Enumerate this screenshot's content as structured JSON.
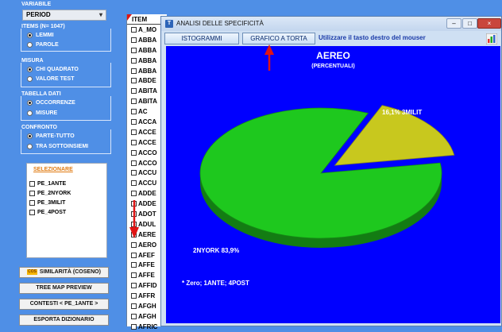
{
  "left_panel": {
    "variable": {
      "title": "VARIABILE",
      "selected": "PERIOD"
    },
    "items": {
      "title": "ITEMS (N= 1047)",
      "options": [
        "LEMMI",
        "PAROLE"
      ],
      "selected_index": 0
    },
    "measure": {
      "title": "MISURA",
      "options": [
        "CHI QUADRATO",
        "VALORE TEST"
      ],
      "selected_index": 0
    },
    "table": {
      "title": "TABELLA DATI",
      "options": [
        "OCCORRENZE",
        "MISURE"
      ],
      "selected_index": 0
    },
    "compare": {
      "title": "CONFRONTO",
      "options": [
        "PARTE-TUTTO",
        "TRA SOTTOINSIEMI"
      ],
      "selected_index": 0
    },
    "select_panel": {
      "title": "SELEZIONARE",
      "items": [
        "PE_1ANTE",
        "PE_2NYORK",
        "PE_3MILIT",
        "PE_4POST"
      ]
    },
    "buttons": {
      "similarity": "SIMILARITÀ (COSENO)",
      "treemap": "TREE MAP PREVIEW",
      "contexts": "CONTESTI  < PE_1ANTE >",
      "export": "ESPORTA DIZIONARIO"
    },
    "similarity_badge": "COS"
  },
  "item_list": {
    "header": "ITEM",
    "rows": [
      "A_MO",
      "ABBA",
      "ABBA",
      "ABBA",
      "ABBA",
      "ABDE",
      "ABITA",
      "ABITA",
      "AC",
      "ACCA",
      "ACCE",
      "ACCE",
      "ACCO",
      "ACCO",
      "ACCU",
      "ACCU",
      "ADDE",
      "ADDE",
      "ADOT",
      "ADUL",
      "AERE",
      "AERO",
      "AFEF",
      "AFFE",
      "AFFE",
      "AFFID",
      "AFFR",
      "AFGH",
      "AFGH",
      "AFRIC"
    ]
  },
  "window": {
    "title": "ANALISI DELLE SPECIFICITÀ",
    "app_icon_letter": "T",
    "controls": {
      "minimize": "–",
      "maximize": "□",
      "close": "×"
    },
    "toolbar": {
      "histograms": "ISTOGRAMMI",
      "pie": "GRAFICO A TORTA",
      "hint": "Utilizzare il tasto destro del mouser"
    }
  },
  "chart_data": {
    "type": "pie",
    "title": "AEREO",
    "subtitle": "(PERCENTUALI)",
    "slices": [
      {
        "label": "2NYORK",
        "value": 83.9,
        "display": "2NYORK  83,9%",
        "color": "#1ec81e"
      },
      {
        "label": "3MILIT",
        "value": 16.1,
        "display": "16,1%  3MILIT",
        "color": "#c8c81e"
      }
    ],
    "annotation": "* Zero; 1ANTE; 4POST"
  },
  "colors": {
    "background": "#4f8fe6",
    "plot_background": "#0000ff",
    "arrow": "#e01414"
  }
}
